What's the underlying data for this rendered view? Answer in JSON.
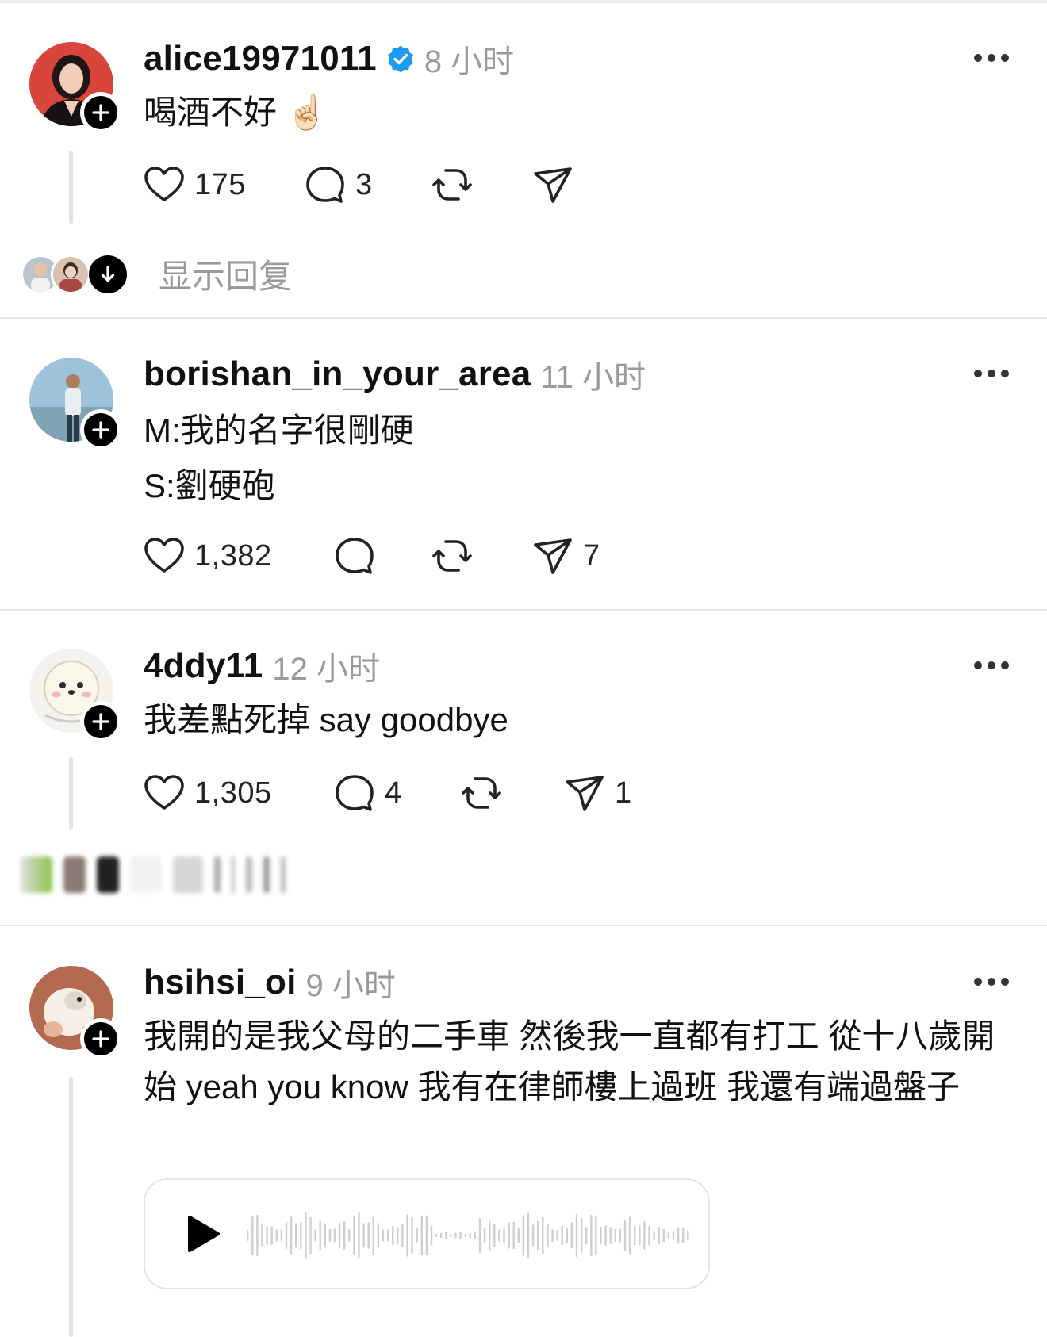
{
  "posts": [
    {
      "username": "alice19971011",
      "verified": true,
      "time": "8 小时",
      "text": "喝酒不好 ☝🏻",
      "likes": "175",
      "comments": "3",
      "reposts": "",
      "shares": "",
      "show_replies": "显示回复"
    },
    {
      "username": "borishan_in_your_area",
      "verified": false,
      "time": "11 小时",
      "text": "M:我的名字很剛硬\nS:劉硬砲",
      "likes": "1,382",
      "comments": "",
      "reposts": "",
      "shares": "7"
    },
    {
      "username": "4ddy11",
      "verified": false,
      "time": "12 小时",
      "text": "我差點死掉 say goodbye",
      "likes": "1,305",
      "comments": "4",
      "reposts": "",
      "shares": "1"
    },
    {
      "username": "hsihsi_oi",
      "verified": false,
      "time": "9 小时",
      "text": "我開的是我父母的二手車 然後我一直都有打工 從十八歲開始 yeah you know 我有在律師樓上過班 我還有端過盤子"
    }
  ],
  "icons": {
    "like": "heart-icon",
    "comment": "comment-bubble-icon",
    "repost": "repost-icon",
    "share": "send-icon",
    "more": "more-dots-icon",
    "follow": "plus-icon",
    "verified": "verified-badge-icon",
    "play": "play-icon",
    "expand": "arrow-down-icon"
  },
  "colors": {
    "verified": "#1d9bf0",
    "muted_text": "#9a9a9a",
    "divider": "#e6e6e6"
  }
}
